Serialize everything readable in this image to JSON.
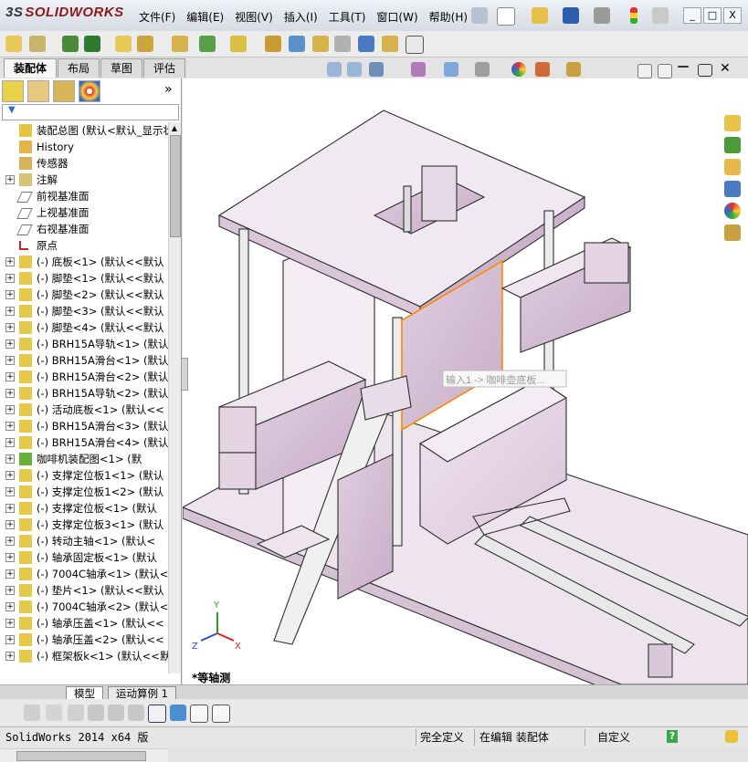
{
  "app": {
    "logo_text": "SOLIDWORKS",
    "logo_prefix": "3S"
  },
  "menu": [
    "文件(F)",
    "编辑(E)",
    "视图(V)",
    "插入(I)",
    "工具(T)",
    "窗口(W)",
    "帮助(H)"
  ],
  "window_controls": {
    "minimize": "_",
    "restore": "□",
    "close": "X"
  },
  "command_tabs": [
    "装配体",
    "布局",
    "草图",
    "评估"
  ],
  "active_tab": "装配体",
  "panel": {
    "expand_glyph": "»",
    "filter_glyph": "▼"
  },
  "tree": [
    {
      "label": "装配总图  (默认<默认_显示状",
      "expander": "",
      "icon": "assembly-icon"
    },
    {
      "label": "History",
      "expander": "",
      "icon": "history-icon"
    },
    {
      "label": "传感器",
      "expander": "",
      "icon": "sensor-icon"
    },
    {
      "label": "注解",
      "expander": "+",
      "icon": "annotation-icon"
    },
    {
      "label": "前视基准面",
      "expander": "",
      "icon": "plane-icon"
    },
    {
      "label": "上视基准面",
      "expander": "",
      "icon": "plane-icon"
    },
    {
      "label": "右视基准面",
      "expander": "",
      "icon": "plane-icon"
    },
    {
      "label": "原点",
      "expander": "",
      "icon": "origin-icon"
    },
    {
      "label": "(-) 底板<1> (默认<<默认",
      "expander": "+",
      "icon": "part-icon"
    },
    {
      "label": "(-) 脚垫<1> (默认<<默认",
      "expander": "+",
      "icon": "part-icon"
    },
    {
      "label": "(-) 脚垫<2> (默认<<默认",
      "expander": "+",
      "icon": "part-icon"
    },
    {
      "label": "(-) 脚垫<3> (默认<<默认",
      "expander": "+",
      "icon": "part-icon"
    },
    {
      "label": "(-) 脚垫<4> (默认<<默认",
      "expander": "+",
      "icon": "part-icon"
    },
    {
      "label": "(-) BRH15A导轨<1> (默认",
      "expander": "+",
      "icon": "part-icon"
    },
    {
      "label": "(-) BRH15A滑台<1> (默认",
      "expander": "+",
      "icon": "part-icon"
    },
    {
      "label": "(-) BRH15A滑台<2> (默认",
      "expander": "+",
      "icon": "part-icon"
    },
    {
      "label": "(-) BRH15A导轨<2> (默认",
      "expander": "+",
      "icon": "part-icon"
    },
    {
      "label": "(-) 活动底板<1> (默认<<",
      "expander": "+",
      "icon": "part-icon"
    },
    {
      "label": "(-) BRH15A滑台<3> (默认",
      "expander": "+",
      "icon": "part-icon"
    },
    {
      "label": "(-) BRH15A滑台<4> (默认",
      "expander": "+",
      "icon": "part-icon"
    },
    {
      "label": "咖啡机装配图<1> (默",
      "expander": "+",
      "icon": "subassembly-icon"
    },
    {
      "label": "(-) 支撑定位板1<1> (默认",
      "expander": "+",
      "icon": "part-icon"
    },
    {
      "label": "(-) 支撑定位板1<2> (默认",
      "expander": "+",
      "icon": "part-icon"
    },
    {
      "label": "(-) 支撑定位板<1> (默认",
      "expander": "+",
      "icon": "part-icon"
    },
    {
      "label": "(-) 支撑定位板3<1> (默认",
      "expander": "+",
      "icon": "part-icon"
    },
    {
      "label": "(-) 转动主轴<1> (默认<",
      "expander": "+",
      "icon": "part-icon"
    },
    {
      "label": "(-) 轴承固定板<1> (默认",
      "expander": "+",
      "icon": "part-icon"
    },
    {
      "label": "(-) 7004C轴承<1> (默认<",
      "expander": "+",
      "icon": "part-icon"
    },
    {
      "label": "(-) 垫片<1> (默认<<默认",
      "expander": "+",
      "icon": "part-icon"
    },
    {
      "label": "(-) 7004C轴承<2> (默认<",
      "expander": "+",
      "icon": "part-icon"
    },
    {
      "label": "(-) 轴承压盖<1> (默认<<",
      "expander": "+",
      "icon": "part-icon"
    },
    {
      "label": "(-) 轴承压盖<2> (默认<<",
      "expander": "+",
      "icon": "part-icon"
    },
    {
      "label": "(-) 框架板k<1> (默认<<默",
      "expander": "+",
      "icon": "part-icon"
    }
  ],
  "viewport": {
    "view_label": "*等轴测",
    "tooltip_text": "输入1 -> 咖啡壶底板...",
    "triad": {
      "x": "X",
      "y": "Y",
      "z": "Z"
    }
  },
  "bottom_tabs": [
    "模型",
    "运动算例 1"
  ],
  "status": {
    "version": "SolidWorks 2014 x64 版",
    "state": "完全定义",
    "mode": "在编辑 装配体",
    "custom": "自定义",
    "help": "?"
  },
  "colors": {
    "part": "#e8d8e8",
    "part_edge": "#3a3a3a",
    "selected": "#ff8a00"
  }
}
